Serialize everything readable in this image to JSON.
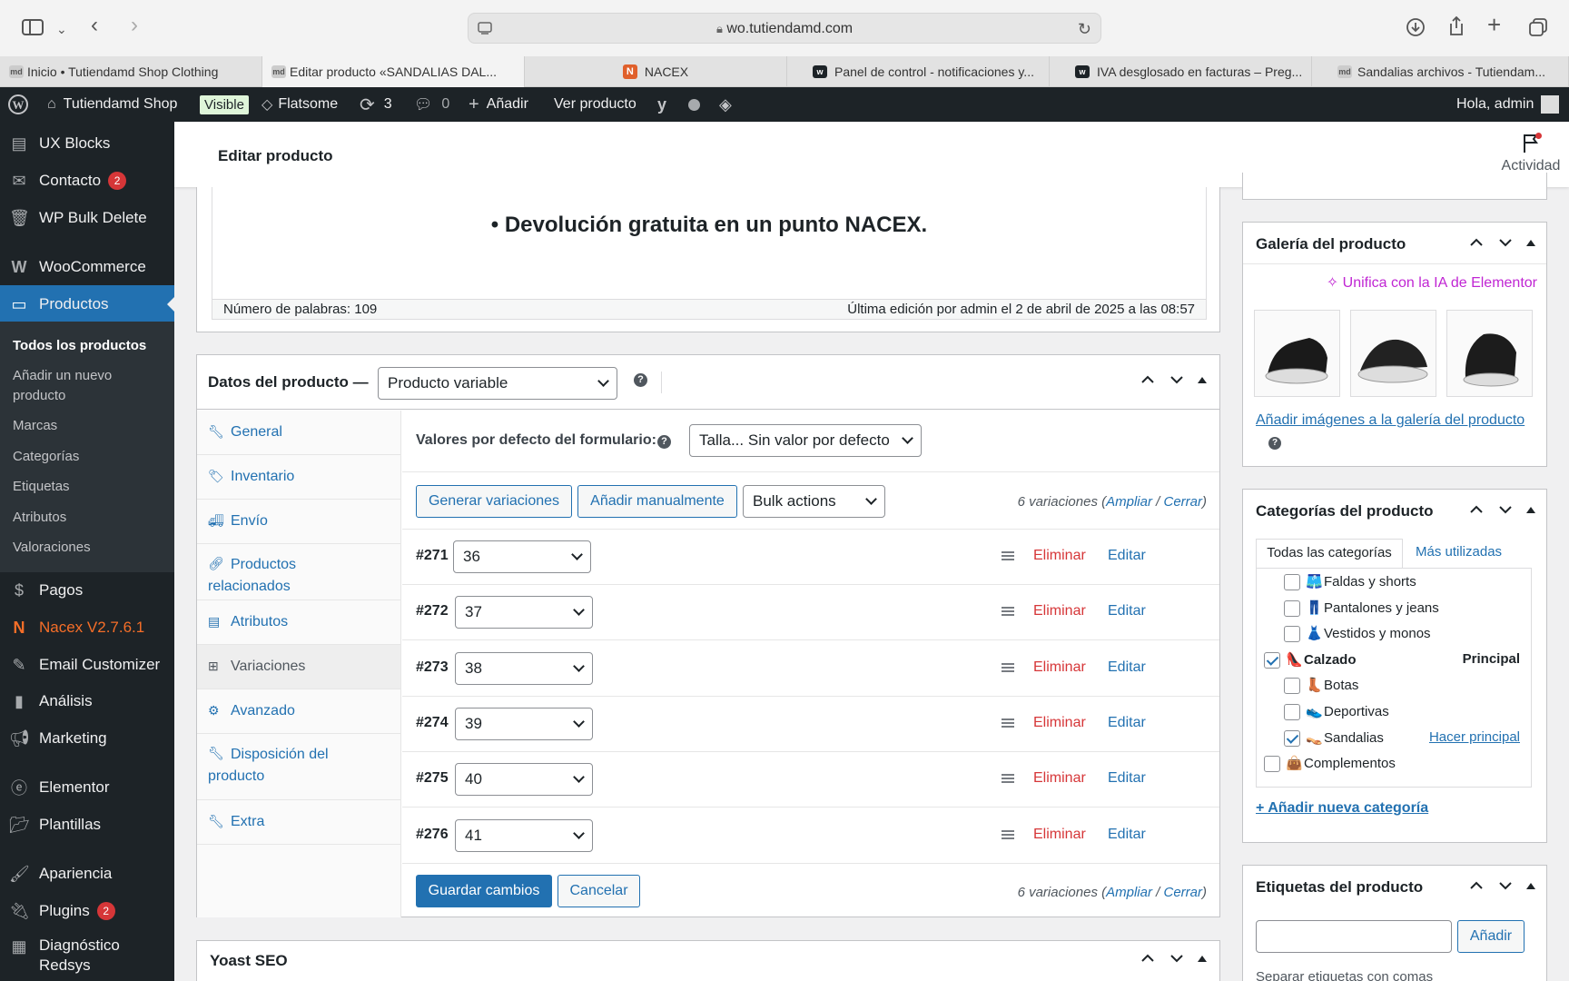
{
  "browser": {
    "url": "wo.tutiendamd.com",
    "tabs": [
      {
        "label": "Inicio • Tutiendamd Shop Clothing",
        "favicon": "md"
      },
      {
        "label": "Editar producto «SANDALIAS DAL...",
        "favicon": "md"
      },
      {
        "label": "NACEX",
        "favicon": "N"
      },
      {
        "label": "Panel de control - notificaciones y...",
        "favicon": "w"
      },
      {
        "label": "IVA desglosado en facturas – Preg...",
        "favicon": "w"
      },
      {
        "label": "Sandalias archivos - Tutiendam...",
        "favicon": "md"
      }
    ]
  },
  "adminbar": {
    "site": "Tutiendamd Shop",
    "visible": "Visible",
    "theme": "Flatsome",
    "updates": "3",
    "comments": "0",
    "add": "Añadir",
    "view": "Ver producto",
    "greeting": "Hola, admin"
  },
  "sidebar": {
    "top_items": [
      "UX Blocks",
      "Contacto",
      "WP Bulk Delete"
    ],
    "contact_badge": "2",
    "woocommerce": "WooCommerce",
    "productos": "Productos",
    "submenu": [
      "Todos los productos",
      "Añadir un nuevo producto",
      "Marcas",
      "Categorías",
      "Etiquetas",
      "Atributos",
      "Valoraciones"
    ],
    "lower_items": [
      "Pagos",
      "Nacex V2.7.6.1",
      "Email Customizer",
      "Análisis",
      "Marketing",
      "Elementor",
      "Plantillas",
      "Apariencia",
      "Plugins",
      "Diagnóstico Redsys"
    ],
    "plugins_badge": "2"
  },
  "header": {
    "title": "Editar producto",
    "activity": "Actividad"
  },
  "editor": {
    "content_line": "• Devolución gratuita en un punto NACEX.",
    "word_count": "Número de palabras: 109",
    "last_edit": "Última edición por admin el 2 de abril de 2025 a las 08:57"
  },
  "product_data": {
    "title": "Datos del producto —",
    "type": "Producto variable",
    "tabs": [
      "General",
      "Inventario",
      "Envío",
      "Productos relacionados",
      "Atributos",
      "Variaciones",
      "Avanzado",
      "Disposición del producto",
      "Extra"
    ],
    "defaults_label": "Valores por defecto del formulario:",
    "defaults_value": "Talla... Sin valor por defecto",
    "generate_btn": "Generar variaciones",
    "add_manual_btn": "Añadir manualmente",
    "bulk_actions": "Bulk actions",
    "variations_count": "6 variaciones (",
    "expand": "Ampliar",
    "sep": " / ",
    "close": "Cerrar",
    "close_paren": ")",
    "variations": [
      {
        "id": "#271",
        "size": "36"
      },
      {
        "id": "#272",
        "size": "37"
      },
      {
        "id": "#273",
        "size": "38"
      },
      {
        "id": "#274",
        "size": "39"
      },
      {
        "id": "#275",
        "size": "40"
      },
      {
        "id": "#276",
        "size": "41"
      }
    ],
    "delete": "Eliminar",
    "edit": "Editar",
    "save_btn": "Guardar cambios",
    "cancel_btn": "Cancelar"
  },
  "yoast": {
    "title": "Yoast SEO"
  },
  "gallery": {
    "title": "Galería del producto",
    "ai_link": "Unifica con la IA de Elementor",
    "add_link": "Añadir imágenes a la galería del producto"
  },
  "categories": {
    "title": "Categorías del producto",
    "tab_all": "Todas las categorías",
    "tab_used": "Más utilizadas",
    "items": [
      {
        "label": "Faldas y shorts",
        "checked": false,
        "emoji": "🩳"
      },
      {
        "label": "Pantalones y jeans",
        "checked": false,
        "emoji": "👖"
      },
      {
        "label": "Vestidos y monos",
        "checked": false,
        "emoji": "👗"
      },
      {
        "label": "Calzado",
        "checked": true,
        "emoji": "👠"
      },
      {
        "label": "Botas",
        "checked": false,
        "emoji": "👢"
      },
      {
        "label": "Deportivas",
        "checked": false,
        "emoji": "👟"
      },
      {
        "label": "Sandalias",
        "checked": true,
        "emoji": "👡"
      },
      {
        "label": "Complementos",
        "checked": false,
        "emoji": "👜"
      }
    ],
    "principal": "Principal",
    "make_principal": "Hacer principal",
    "add_new": "+ Añadir nueva categoría"
  },
  "tags": {
    "title": "Etiquetas del producto",
    "add_btn": "Añadir",
    "hint": "Separar etiquetas con comas"
  },
  "colors": {
    "admin_dark": "#1d2327",
    "accent": "#2271b1",
    "danger": "#d63638",
    "nacex": "#f56e28"
  }
}
